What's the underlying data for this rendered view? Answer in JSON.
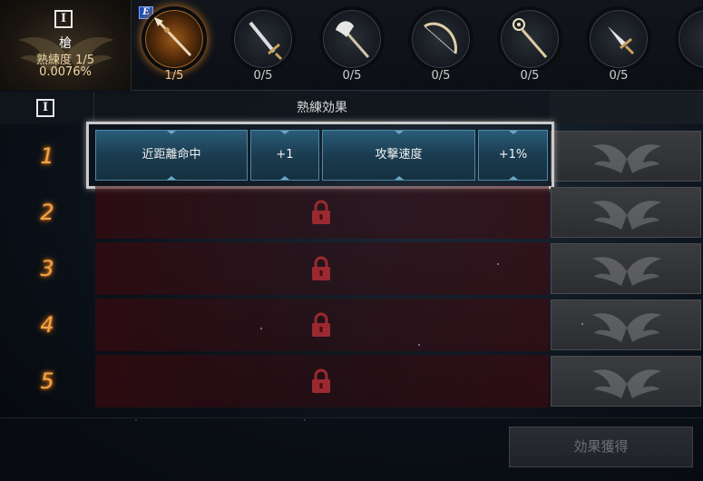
{
  "weapon_info": {
    "rank_icon": "roman-one-icon",
    "rank_glyph": "I",
    "name": "槍",
    "level": "熟練度 1/5",
    "percent": "0.0076%"
  },
  "weapon_badge": "E",
  "weapons": [
    {
      "icon": "spear-icon",
      "count": "1/5",
      "active": true
    },
    {
      "icon": "sword-icon",
      "count": "0/5",
      "active": false
    },
    {
      "icon": "axe-icon",
      "count": "0/5",
      "active": false
    },
    {
      "icon": "bow-icon",
      "count": "0/5",
      "active": false
    },
    {
      "icon": "staff-icon",
      "count": "0/5",
      "active": false
    },
    {
      "icon": "dagger-icon",
      "count": "0/5",
      "active": false
    },
    {
      "icon": "partial-weapon-icon",
      "count": "",
      "active": false
    }
  ],
  "header": {
    "rank_glyph": "I",
    "title": "熟練効果"
  },
  "rows": [
    {
      "num": "1",
      "unlocked": true,
      "effects": [
        {
          "label": "近距離命中",
          "value": "+1"
        },
        {
          "label": "攻撃速度",
          "value": "+1%"
        }
      ]
    },
    {
      "num": "2",
      "unlocked": false
    },
    {
      "num": "3",
      "unlocked": false
    },
    {
      "num": "4",
      "unlocked": false
    },
    {
      "num": "5",
      "unlocked": false
    }
  ],
  "acquire_button": "効果獲得",
  "colors": {
    "accent_orange": "#f3a545",
    "effect_blue": "#2a5c78",
    "locked_red": "#460810",
    "lock_icon": "#9a2a30"
  }
}
